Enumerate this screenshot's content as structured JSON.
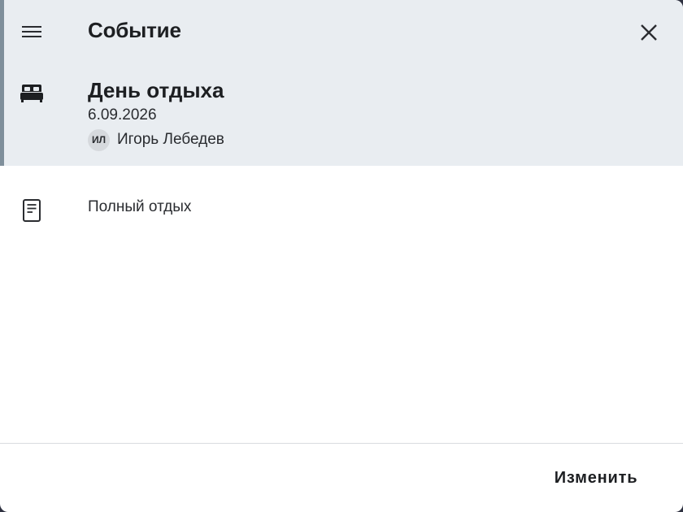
{
  "dialog": {
    "title": "Событие",
    "menu_icon": "menu-icon",
    "close_icon": "close-icon"
  },
  "event": {
    "icon": "bed-icon",
    "name": "День отдыха",
    "date": "6.09.2026",
    "person": {
      "initials": "ИЛ",
      "name": "Игорь Лебедев"
    }
  },
  "note": {
    "icon": "note-icon",
    "text": "Полный отдых"
  },
  "footer": {
    "edit_label": "Изменить"
  },
  "colors": {
    "header_bg": "#e9edf1",
    "text": "#1d1f22",
    "avatar_bg": "#d6d9dd"
  }
}
